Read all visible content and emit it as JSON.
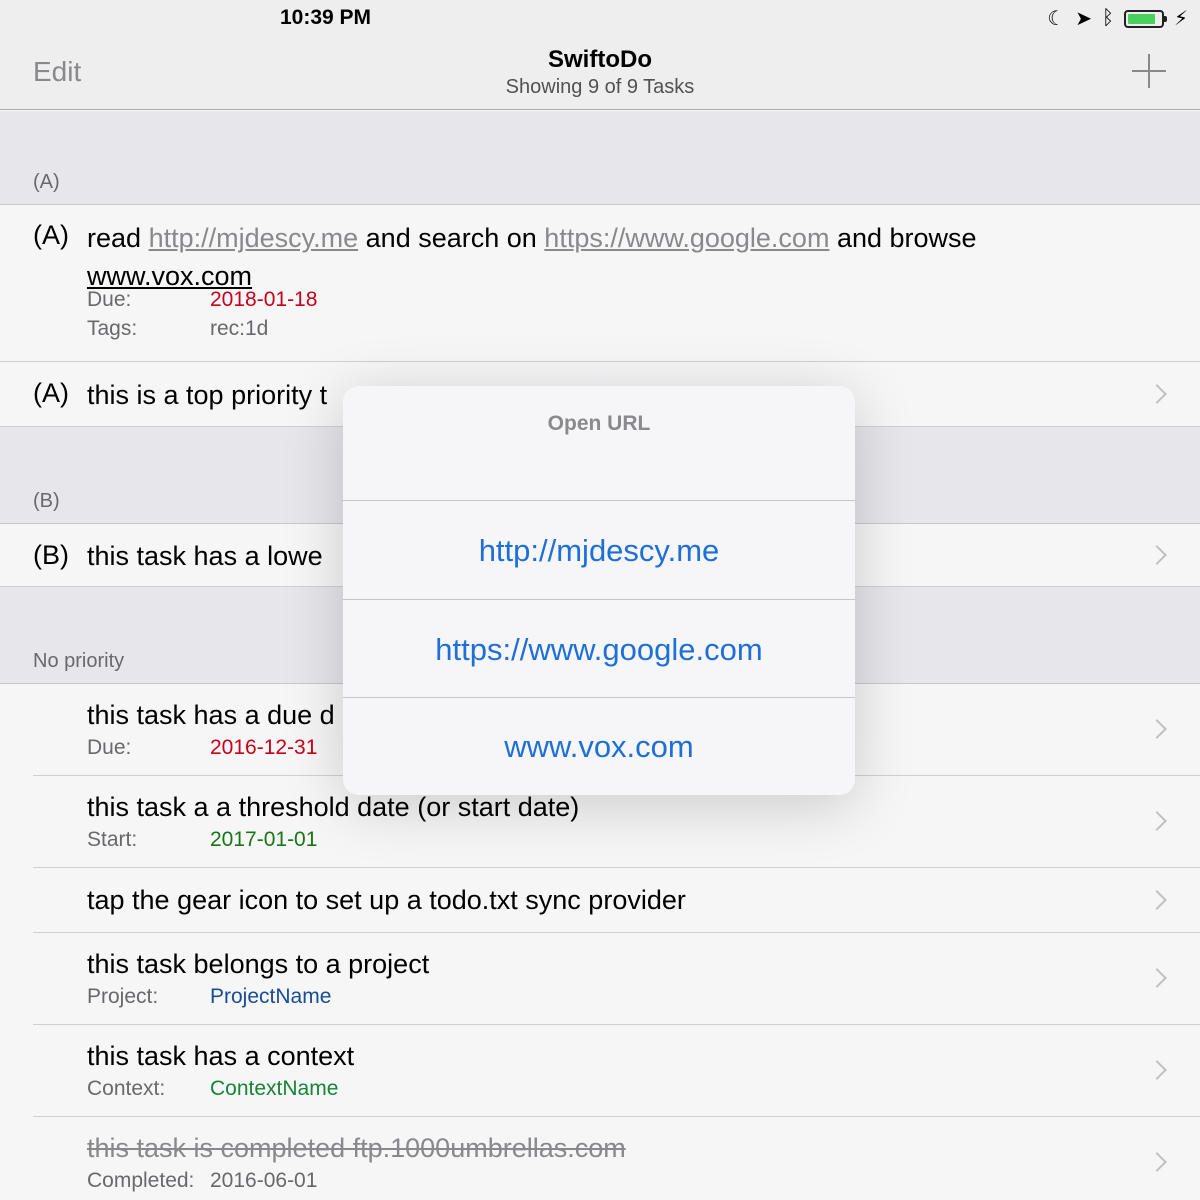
{
  "status": {
    "time": "10:39 PM",
    "icons": [
      "moon-icon",
      "location-icon",
      "bluetooth-icon",
      "battery-icon",
      "charging-icon"
    ]
  },
  "nav": {
    "edit_label": "Edit",
    "title": "SwiftoDo",
    "subtitle": "Showing 9 of 9 Tasks",
    "add_icon": "plus-icon"
  },
  "sections": {
    "a": "(A)",
    "b": "(B)",
    "none": "No priority"
  },
  "tasks": {
    "t1": {
      "priority": "(A)",
      "w_read": "read",
      "link1": "http://mjdescy.me",
      "w_search": "and search on",
      "link2": "https://www.google.com",
      "w_browse": "and browse",
      "link3": "www.vox.com",
      "due_label": "Due:",
      "due_value": "2018-01-18",
      "tags_label": "Tags:",
      "tags_value": "rec:1d"
    },
    "t2": {
      "priority": "(A)",
      "text": "this is a top priority t"
    },
    "t3": {
      "priority": "(B)",
      "text": "this task has a lowe"
    },
    "t4": {
      "text": "this task has a due d",
      "due_label": "Due:",
      "due_value": "2016-12-31"
    },
    "t5": {
      "text": "this task a a threshold date (or start date)",
      "start_label": "Start:",
      "start_value": "2017-01-01"
    },
    "t6": {
      "text": "tap the gear icon to set up a todo.txt sync provider"
    },
    "t7": {
      "text": "this task belongs to a project",
      "project_label": "Project:",
      "project_value": "ProjectName"
    },
    "t8": {
      "text": "this task has a context",
      "context_label": "Context:",
      "context_value": "ContextName"
    },
    "t9": {
      "text": "this task is completed ftp.1000umbrellas.com",
      "completed_label": "Completed:",
      "completed_value": "2016-06-01"
    }
  },
  "popover": {
    "title": "Open URL",
    "options": [
      "http://mjdescy.me",
      "https://www.google.com",
      "www.vox.com"
    ]
  },
  "colors": {
    "link_blue": "#1f6fd8",
    "due_red": "#d0021b",
    "start_green": "#1a7a1a",
    "project_blue": "#1b4f9c",
    "context_green": "#18893a"
  }
}
